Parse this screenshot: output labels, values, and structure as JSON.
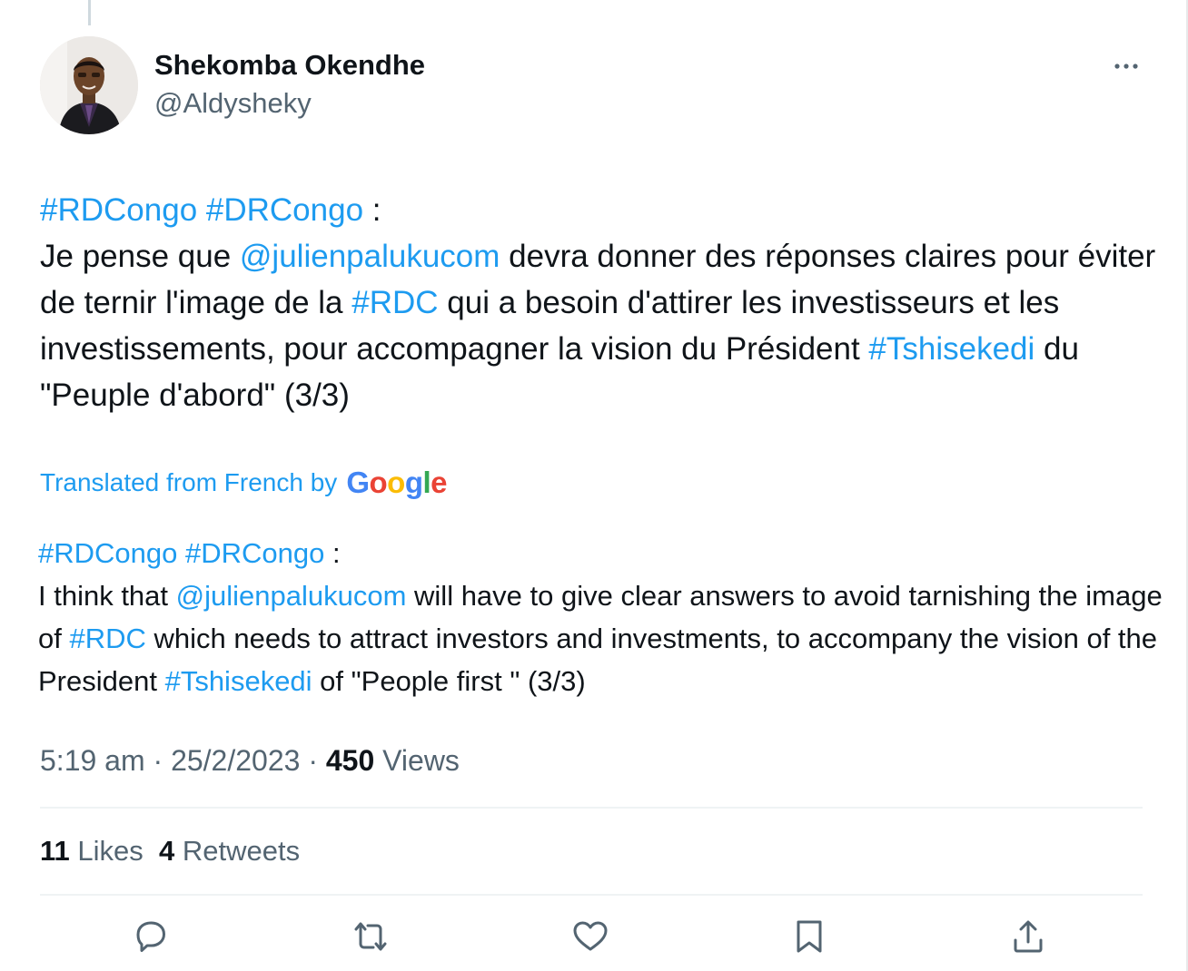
{
  "tweet": {
    "author": {
      "display_name": "Shekomba Okendhe",
      "handle": "@Aldysheky"
    },
    "original": {
      "hashtag_1": "#RDCongo",
      "hashtag_2": "#DRCongo",
      "colon": " :",
      "line_intro": "Je pense que ",
      "mention": "@julienpalukucom",
      "text_a": " devra donner des réponses claires pour éviter de ternir l'image de la ",
      "hashtag_rdc": "#RDC",
      "text_b": " qui a besoin d'attirer les investisseurs et les investissements, pour accompagner la vision du Président ",
      "hashtag_tshisekedi": "#Tshisekedi",
      "text_c": " du \"Peuple d'abord\" (3/3)"
    },
    "translation_label": "Translated from French by",
    "translation_provider": "Google",
    "translation": {
      "hashtag_1": "#RDCongo",
      "hashtag_2": "#DRCongo",
      "colon": " :",
      "line_intro": "I think that ",
      "mention": "@julienpalukucom",
      "text_a": " will have to give clear answers to avoid tarnishing the image of ",
      "hashtag_rdc": "#RDC",
      "text_b": " which needs to attract investors and investments, to accompany the vision of the President ",
      "hashtag_tshisekedi": "#Tshisekedi",
      "text_c": " of \"People first \" (3/3)"
    },
    "meta": {
      "time": "5:19 am",
      "separator": " · ",
      "date": "25/2/2023",
      "views_count": "450",
      "views_label": " Views"
    },
    "stats": {
      "likes_count": "11",
      "likes_label": " Likes",
      "retweets_count": "4",
      "retweets_label": " Retweets"
    },
    "actions": [
      "reply-icon",
      "retweet-icon",
      "like-icon",
      "bookmark-icon",
      "share-icon"
    ],
    "colors": {
      "link": "#1d9bf0",
      "text": "#0f1419",
      "secondary": "#536471"
    }
  }
}
